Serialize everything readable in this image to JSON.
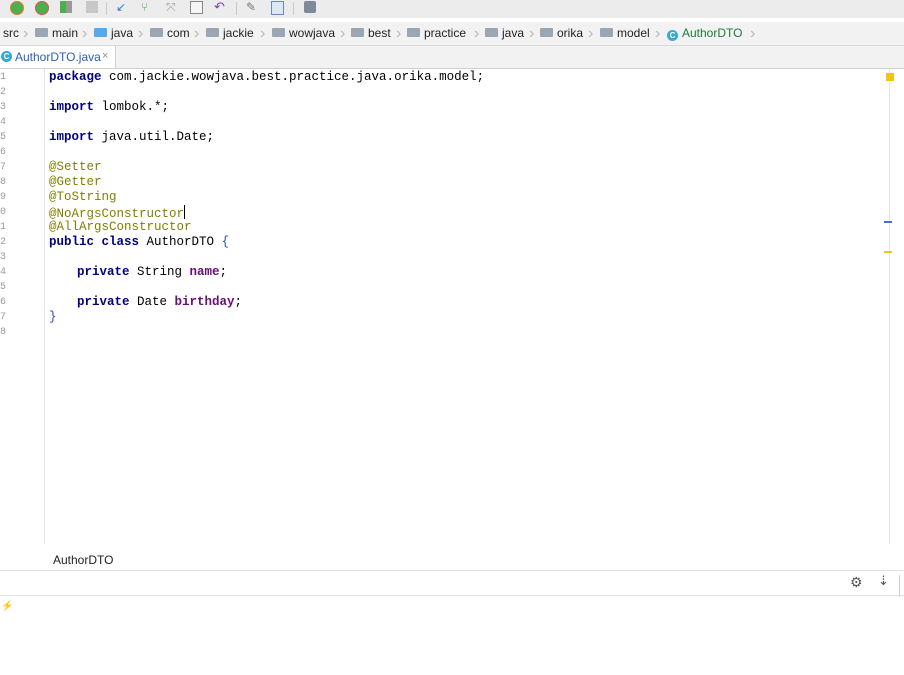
{
  "toolbar": {
    "icons": [
      "debug-icon",
      "stop-run-icon",
      "coverage-icon",
      "stop-icon",
      "vcs-update-icon",
      "vcs-branch-icon",
      "vcs-pull-icon",
      "commit-icon",
      "revert-icon",
      "build-icon",
      "structure-icon",
      "deploy-icon"
    ],
    "colors": {
      "green": "#4caf50",
      "orange": "#e8772e"
    }
  },
  "breadcrumbs": [
    {
      "label": "src",
      "folder": false
    },
    {
      "label": "main",
      "folder": true
    },
    {
      "label": "java",
      "folder": true,
      "blue": true
    },
    {
      "label": "com",
      "folder": true
    },
    {
      "label": "jackie",
      "folder": true
    },
    {
      "label": "wowjava",
      "folder": true
    },
    {
      "label": "best",
      "folder": true
    },
    {
      "label": "practice",
      "folder": true
    },
    {
      "label": "java",
      "folder": true
    },
    {
      "label": "orika",
      "folder": true
    },
    {
      "label": "model",
      "folder": true
    },
    {
      "label": "AuthorDTO",
      "class_icon": true
    }
  ],
  "tab": {
    "label": "AuthorDTO.java",
    "close": "×",
    "icon": "C"
  },
  "editor": {
    "line_numbers": [
      "1",
      "2",
      "3",
      "4",
      "5",
      "6",
      "7",
      "8",
      "9",
      "0",
      "1",
      "2",
      "3",
      "4",
      "5",
      "6",
      "7",
      "8"
    ],
    "lines": {
      "l1": {
        "kw": "package",
        "rest": " com.jackie.wowjava.best.practice.java.orika.model;"
      },
      "l3": {
        "kw": "import",
        "rest": " lombok.*;"
      },
      "l5": {
        "kw": "import",
        "rest": " java.util.Date;"
      },
      "l7": "@Setter",
      "l8": "@Getter",
      "l9": "@ToString",
      "l10": "@NoArgsConstructor",
      "l11": "@AllArgsConstructor",
      "l12": {
        "kw1": "public",
        "kw2": "class",
        "rest": " AuthorDTO ",
        "brace": "{"
      },
      "l14": {
        "kw": "private",
        "type": " String ",
        "field": "name",
        "end": ";"
      },
      "l16": {
        "kw": "private",
        "type": " Date ",
        "field": "birthday",
        "end": ";"
      },
      "l17": "}"
    }
  },
  "status": {
    "label": "AuthorDTO"
  },
  "panel": {
    "gear": "⚙",
    "download": "⇣",
    "bolt": "⚡"
  }
}
